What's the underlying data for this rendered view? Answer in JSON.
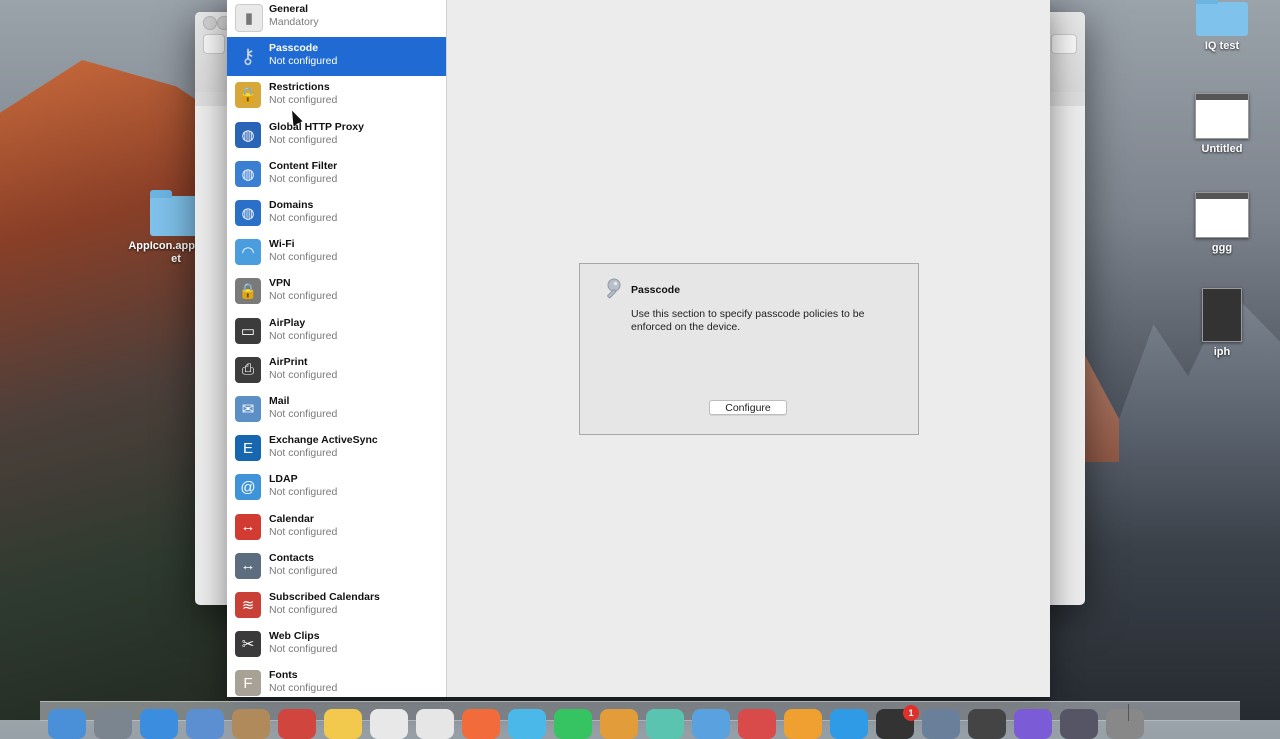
{
  "desktop": {
    "icons": [
      {
        "label": "IQ test",
        "kind": "folder"
      },
      {
        "label": "Untitled",
        "kind": "thumbnail"
      },
      {
        "label": "ggg",
        "kind": "thumbnail"
      },
      {
        "label": "iph",
        "kind": "phone-thumbnail"
      },
      {
        "label": "AppIcon.appiconset",
        "kind": "folder"
      }
    ],
    "notification_badge": "1"
  },
  "sidebar": {
    "items": [
      {
        "title": "General",
        "status": "Mandatory",
        "icon": "switch-icon",
        "color": "#e9e9e9"
      },
      {
        "title": "Passcode",
        "status": "Not configured",
        "icon": "key-icon",
        "color": "#1f6ad3",
        "selected": true
      },
      {
        "title": "Restrictions",
        "status": "Not configured",
        "icon": "lock-icon",
        "color": "#d8a73a"
      },
      {
        "title": "Global HTTP Proxy",
        "status": "Not configured",
        "icon": "globe-icon",
        "color": "#2a64b6"
      },
      {
        "title": "Content Filter",
        "status": "Not configured",
        "icon": "globe-filter-icon",
        "color": "#3b7fd3"
      },
      {
        "title": "Domains",
        "status": "Not configured",
        "icon": "globe-icon",
        "color": "#2a70c8"
      },
      {
        "title": "Wi-Fi",
        "status": "Not configured",
        "icon": "wifi-icon",
        "color": "#4a9ede"
      },
      {
        "title": "VPN",
        "status": "Not configured",
        "icon": "vpn-lock-icon",
        "color": "#7a7a7a"
      },
      {
        "title": "AirPlay",
        "status": "Not configured",
        "icon": "airplay-icon",
        "color": "#3c3c3c"
      },
      {
        "title": "AirPrint",
        "status": "Not configured",
        "icon": "printer-icon",
        "color": "#3c3c3c"
      },
      {
        "title": "Mail",
        "status": "Not configured",
        "icon": "mail-icon",
        "color": "#5d8fc7"
      },
      {
        "title": "Exchange ActiveSync",
        "status": "Not configured",
        "icon": "exchange-icon",
        "color": "#1766b0"
      },
      {
        "title": "LDAP",
        "status": "Not configured",
        "icon": "ldap-icon",
        "color": "#3e93d9"
      },
      {
        "title": "Calendar",
        "status": "Not configured",
        "icon": "calendar-icon",
        "color": "#d23b31"
      },
      {
        "title": "Contacts",
        "status": "Not configured",
        "icon": "contacts-icon",
        "color": "#5c6d80"
      },
      {
        "title": "Subscribed Calendars",
        "status": "Not configured",
        "icon": "subscribed-calendar-icon",
        "color": "#c94136"
      },
      {
        "title": "Web Clips",
        "status": "Not configured",
        "icon": "scissors-icon",
        "color": "#3a3a3a"
      },
      {
        "title": "Fonts",
        "status": "Not configured",
        "icon": "font-icon",
        "color": "#a7a196"
      }
    ]
  },
  "detail": {
    "section": {
      "title": "Passcode",
      "description": "Use this section to specify passcode policies to be enforced on the device.",
      "button_label": "Configure",
      "icon": "key-icon"
    }
  }
}
